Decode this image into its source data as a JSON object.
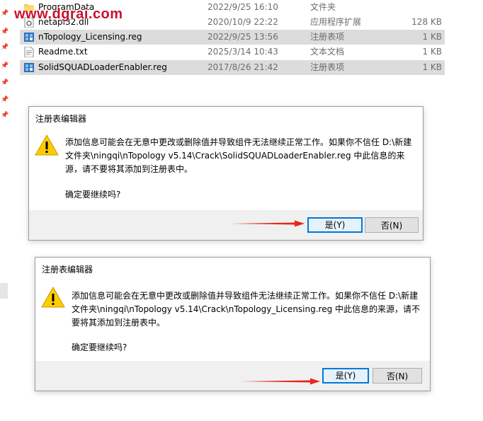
{
  "watermark": "www.dgrai.com",
  "files": [
    {
      "name": "ProgramData",
      "date": "2022/9/25 16:10",
      "type": "文件夹",
      "size": "",
      "icon": "folder-icon",
      "selected": false
    },
    {
      "name": "netapi32.dll",
      "date": "2020/10/9 22:22",
      "type": "应用程序扩展",
      "size": "128 KB",
      "icon": "dll-file-icon",
      "selected": false
    },
    {
      "name": "nTopology_Licensing.reg",
      "date": "2022/9/25 13:56",
      "type": "注册表项",
      "size": "1 KB",
      "icon": "registry-file-icon",
      "selected": true
    },
    {
      "name": "Readme.txt",
      "date": "2025/3/14 10:43",
      "type": "文本文档",
      "size": "1 KB",
      "icon": "text-file-icon",
      "selected": false
    },
    {
      "name": "SolidSQUADLoaderEnabler.reg",
      "date": "2017/8/26 21:42",
      "type": "注册表项",
      "size": "1 KB",
      "icon": "registry-file-icon",
      "selected": true
    }
  ],
  "dialog1": {
    "title": "注册表编辑器",
    "message_lines": [
      "添加信息可能会在无意中更改或删除值并导致组件无法继续正常工作。如果你不信任 D:\\新建",
      "文件夹\\ningqi\\nTopology v5.14\\Crack\\SolidSQUADLoaderEnabler.reg 中此信息的来",
      "源，请不要将其添加到注册表中。"
    ],
    "confirm": "确定要继续吗?",
    "yes_label": "是(Y)",
    "no_label": "否(N)"
  },
  "dialog2": {
    "title": "注册表编辑器",
    "message_lines": [
      "添加信息可能会在无意中更改或删除值并导致组件无法继续正常工作。如果你不信任 D:\\新建",
      "文件夹\\ningqi\\nTopology v5.14\\Crack\\nTopology_Licensing.reg 中此信息的来源，请不",
      "要将其添加到注册表中。"
    ],
    "confirm": "确定要继续吗?",
    "yes_label": "是(Y)",
    "no_label": "否(N)"
  },
  "colors": {
    "annotation_arrow": "#e8261c",
    "watermark": "#c8102e",
    "default_button_border": "#0078d7"
  }
}
